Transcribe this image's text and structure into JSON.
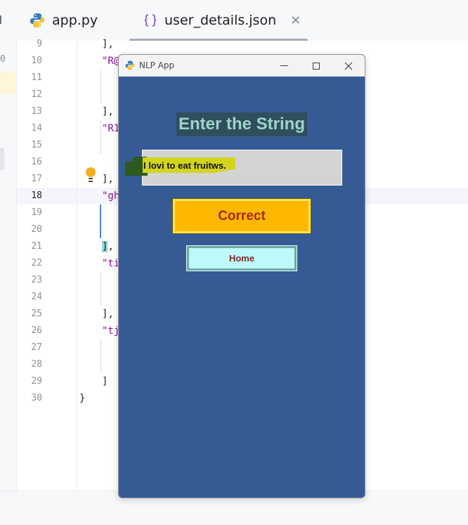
{
  "ide": {
    "tabs": [
      {
        "label": "app.py",
        "icon": "python-icon"
      },
      {
        "label": "user_details.json",
        "icon": "json-braces-icon"
      }
    ],
    "left_strip_glyph": "0",
    "line_numbers": [
      "9",
      "10",
      "11",
      "12",
      "13",
      "14",
      "15",
      "16",
      "17",
      "18",
      "19",
      "20",
      "21",
      "22",
      "23",
      "24",
      "25",
      "26",
      "27",
      "28",
      "29",
      "30"
    ],
    "current_line": "18",
    "code": {
      "l9": "],",
      "l10": "\"R@",
      "l13": "],",
      "l14": "\"R1",
      "l17": "],",
      "l18": "\"gh",
      "l21_bracket": "]",
      "l21_comma": ",",
      "l22": "\"ti",
      "l25": "],",
      "l26": "\"tj",
      "l29": "]",
      "l30": "}"
    }
  },
  "app_window": {
    "title": "NLP App",
    "heading": "Enter the String",
    "entry_value": "I lovi to eat fruitws.",
    "correct_button": "Correct",
    "home_button": "Home"
  },
  "colors": {
    "window_bg": "#365b94",
    "heading_bg": "#2f4f5c",
    "heading_fg": "#9fd4c9",
    "entry_bg": "#d3d3d3",
    "correct_bg": "#ffb800",
    "correct_fg": "#a22a1a",
    "home_bg": "#bff8f8",
    "home_fg": "#7a2a2a"
  }
}
